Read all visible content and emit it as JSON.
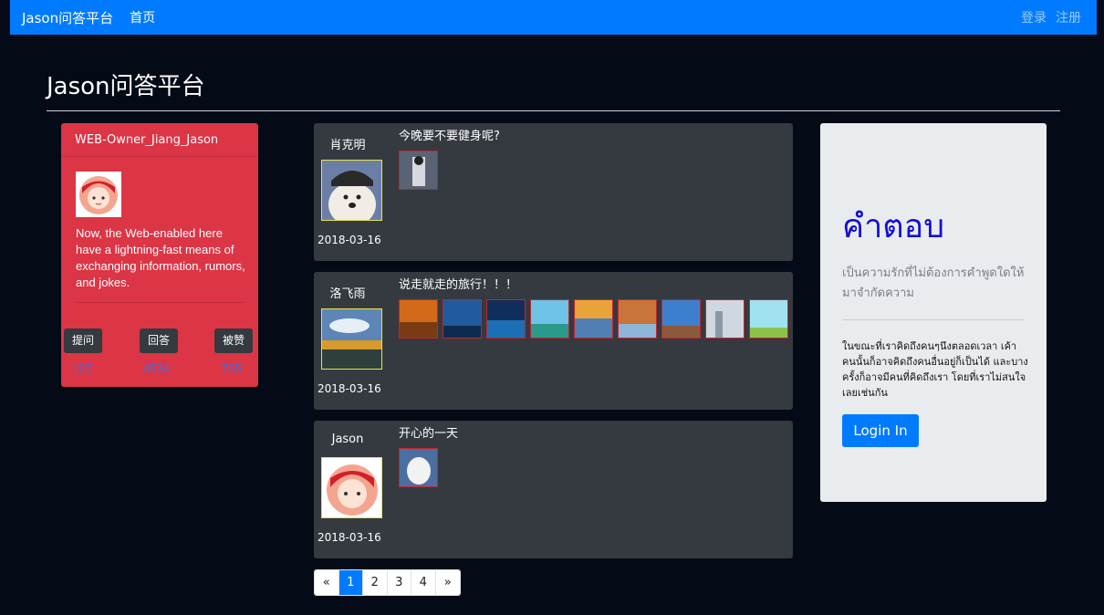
{
  "nav": {
    "brand": "Jason问答平台",
    "home": "首页",
    "login": "登录",
    "register": "注册"
  },
  "page_title": "Jason问答平台",
  "profile": {
    "header": "WEB-Owner_Jiang_Jason",
    "bio": "Now, the Web-enabled here have a lightning-fast means of exchanging information, rumors, and jokes.",
    "stats": [
      {
        "label": "提问",
        "value": "122"
      },
      {
        "label": "回答",
        "value": "4534"
      },
      {
        "label": "被赞",
        "value": "765"
      }
    ]
  },
  "questions": [
    {
      "user": "肖克明",
      "date": "2018-03-16",
      "title": "今晚要不要健身呢?",
      "thumb_count": 1
    },
    {
      "user": "洛飞雨",
      "date": "2018-03-16",
      "title": "说走就走的旅行！！！",
      "thumb_count": 9
    },
    {
      "user": "Jason",
      "date": "2018-03-16",
      "title": "开心的一天",
      "thumb_count": 1
    }
  ],
  "pagination": [
    "«",
    "1",
    "2",
    "3",
    "4",
    "»"
  ],
  "pagination_active": "1",
  "jumbotron": {
    "title": "คำตอบ",
    "lead": "เป็นความรักที่ไม่ต้องการคำพูดใดให้มาจำกัดความ",
    "text": "ในขณะที่เราคิดถึงคนๆนึงตลอดเวลา เค้าคนนั้นก็อาจคิดถึงคนอื่นอยู่ก็เป็นได้ และบางครั้งก็อาจมีคนที่คิดถึงเรา โดยที่เราไม่สนใจเลยเช่นกัน",
    "button": "Login In"
  },
  "colors": {
    "navbar": "#007bff",
    "profile_card": "#dc3545",
    "question_card": "#343a40",
    "background": "#040b17"
  }
}
